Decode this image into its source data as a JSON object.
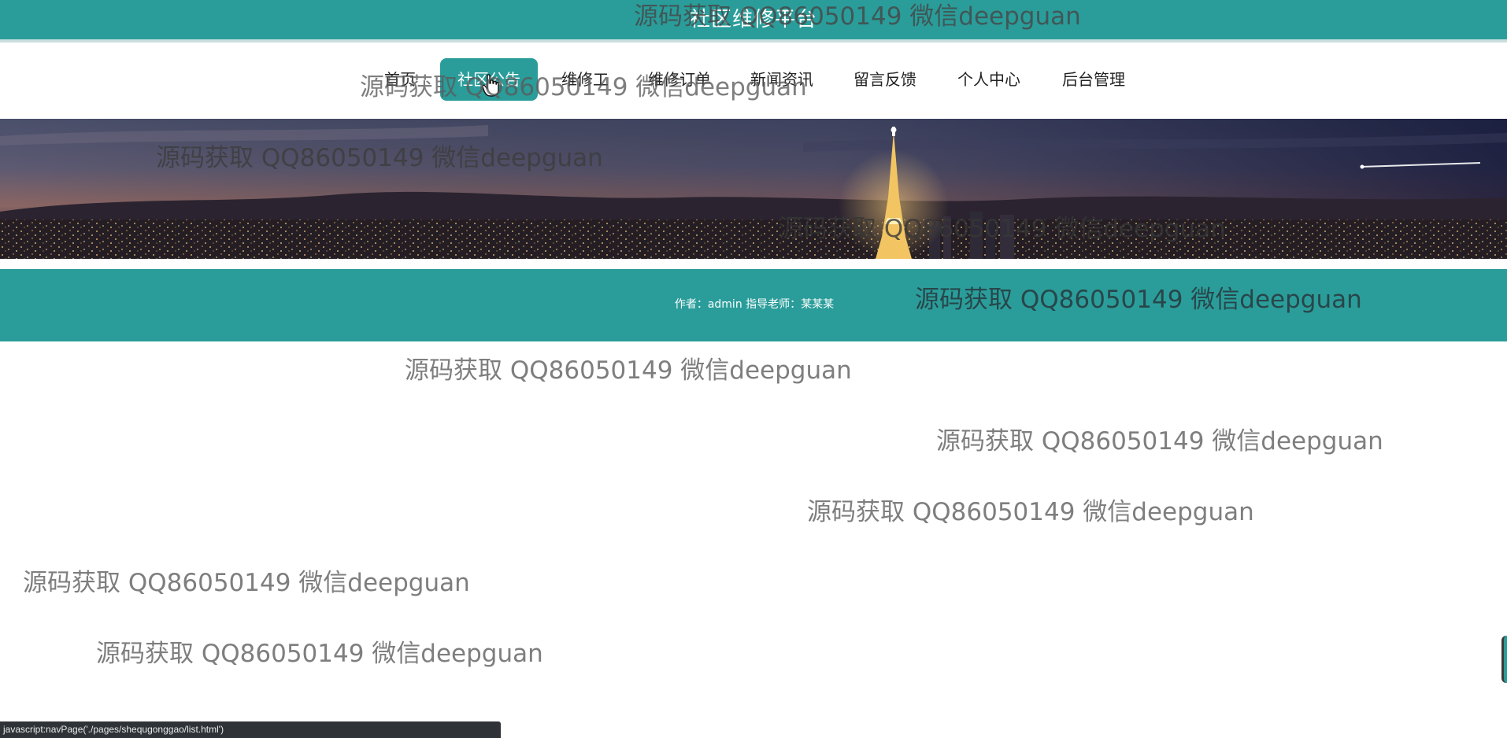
{
  "header": {
    "title": "社区维修平台"
  },
  "nav": {
    "items": [
      {
        "label": "首页"
      },
      {
        "label": "社区公告"
      },
      {
        "label": "维修工"
      },
      {
        "label": "维修订单"
      },
      {
        "label": "新闻资讯"
      },
      {
        "label": "留言反馈"
      },
      {
        "label": "个人中心"
      },
      {
        "label": "后台管理"
      }
    ],
    "active_index": 1
  },
  "footer": {
    "credits": "作者：admin 指导老师：某某某"
  },
  "watermark": {
    "text": "源码获取 QQ86050149 微信deepguan"
  },
  "statusbar": {
    "text": "javascript:navPage('./pages/shequgonggao/list.html')"
  },
  "colors": {
    "primary": "#2a9d9a",
    "statusbar_bg": "#2f3338"
  },
  "icons": {
    "cursor": "hand-pointer-icon"
  }
}
